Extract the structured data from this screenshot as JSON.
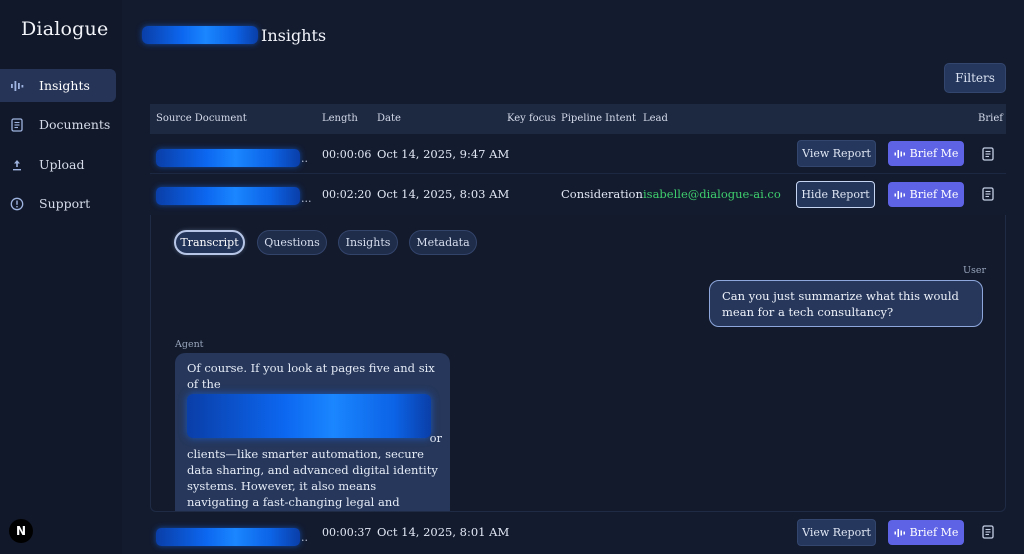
{
  "app": {
    "brand": "Dialogue"
  },
  "sidebar": {
    "items": [
      {
        "label": "Insights",
        "icon": "audio-bars-icon",
        "active": true
      },
      {
        "label": "Documents",
        "icon": "document-icon",
        "active": false
      },
      {
        "label": "Upload",
        "icon": "upload-icon",
        "active": false
      },
      {
        "label": "Support",
        "icon": "info-circle-icon",
        "active": false
      }
    ],
    "footer_logo": "N"
  },
  "header": {
    "title": "Insights",
    "filters_label": "Filters"
  },
  "table": {
    "columns": [
      "Source Document",
      "Length",
      "Date",
      "Key focus",
      "Pipeline Intent",
      "Lead",
      "Brief"
    ],
    "rows": [
      {
        "source_suffix": "..",
        "length": "00:00:06",
        "date": "Oct 14, 2025, 9:47 AM",
        "key_focus": "",
        "intent": "",
        "lead": "",
        "report_label": "View Report",
        "brief_label": "Brief Me"
      },
      {
        "source_suffix": "...",
        "length": "00:02:20",
        "date": "Oct 14, 2025, 8:03 AM",
        "key_focus": "",
        "intent": "Consideration",
        "lead": "isabelle@dialogue-ai.co",
        "report_label": "Hide Report",
        "brief_label": "Brief Me"
      },
      {
        "source_suffix": "..",
        "length": "00:00:37",
        "date": "Oct 14, 2025, 8:01 AM",
        "key_focus": "",
        "intent": "",
        "lead": "",
        "report_label": "View Report",
        "brief_label": "Brief Me"
      }
    ]
  },
  "report": {
    "tabs": [
      "Transcript",
      "Questions",
      "Insights",
      "Metadata"
    ],
    "active_tab": "Transcript",
    "messages": [
      {
        "speaker": "User",
        "text": "Can you just summarize what this would mean for a tech consultancy?"
      },
      {
        "speaker": "Agent",
        "text_before": "Of course. If you look at pages five and six of the",
        "text_tail": "or",
        "text_after": "clients—like smarter automation, secure data sharing, and advanced digital identity systems. However, it also means navigating a fast-changing legal and regulatory landscape, building internal expertise, and aligning new technologies with client needs and"
      }
    ]
  },
  "colors": {
    "accent": "#5e63e6",
    "lead": "#3fcf6d",
    "background": "#131b2f",
    "redaction": "#0c67f0"
  }
}
